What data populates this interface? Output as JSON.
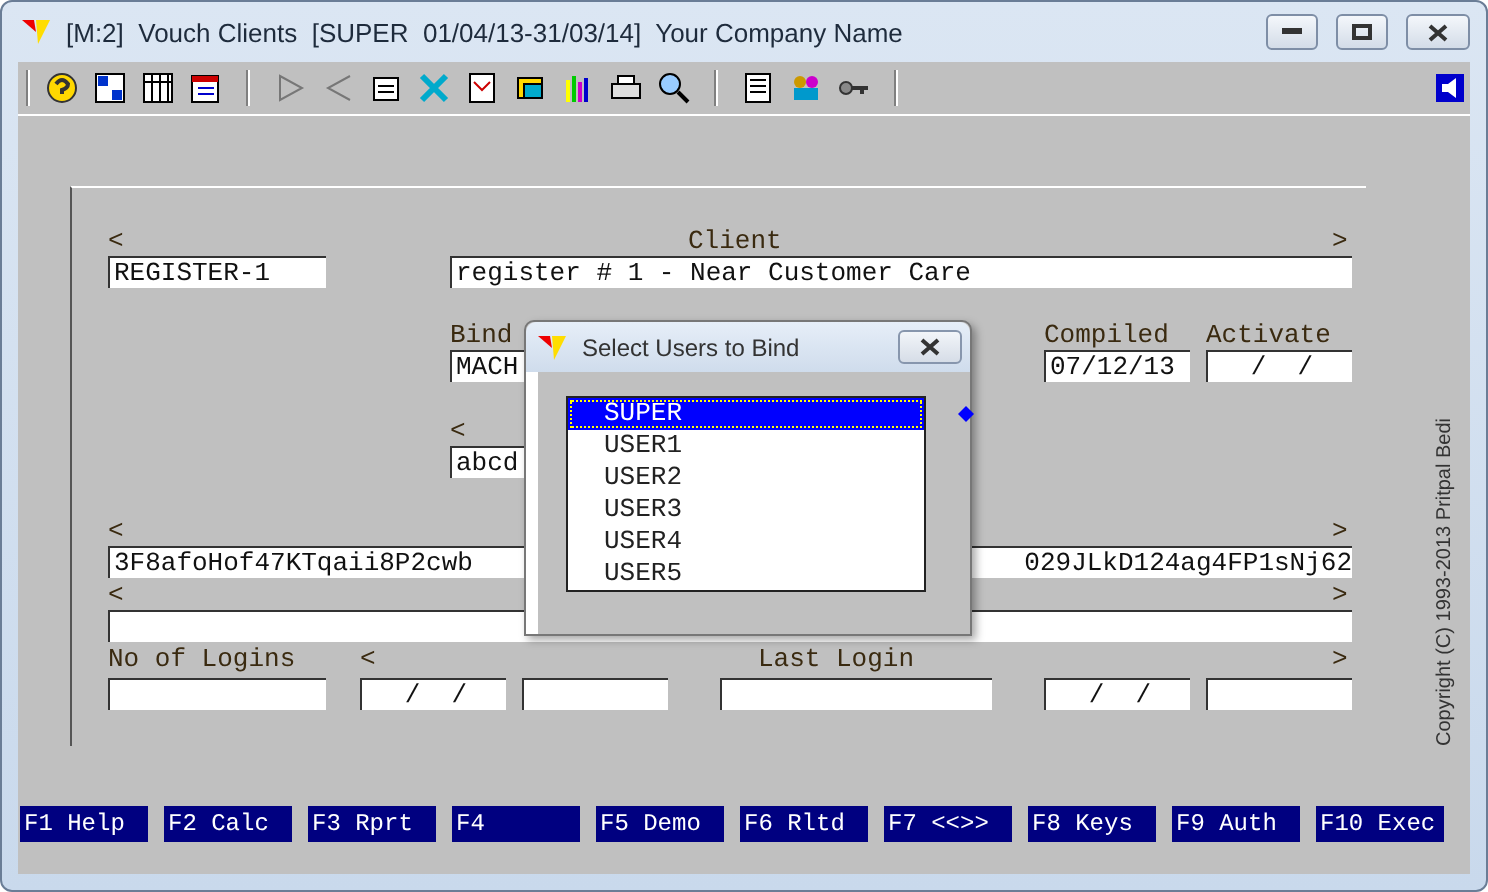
{
  "window": {
    "title": "[M:2]  Vouch Clients  [SUPER  01/04/13-31/03/14]  Your Company Name"
  },
  "form": {
    "code_marker": "<",
    "client_label": "Client",
    "client_marker": ">",
    "code": "REGISTER-1",
    "client": "register # 1 - Near Customer Care",
    "bind_label": "Bind",
    "bind": "MACH",
    "compiled_label": "Compiled",
    "compiled": "07/12/13",
    "activate_label": "Activate",
    "activate": "/  /",
    "field_5_marker": "<",
    "field_5": "abcd",
    "key_marker_left": "<",
    "key_marker_right": ">",
    "key_start": "3F8afoHof47KTqaii8P2cwb",
    "key_end": "029JLkD124ag4FP1sNj62",
    "note_marker_left": "<",
    "note_marker_right": ">",
    "logins_label": "No of Logins",
    "last_marker_left": "<",
    "last_login_label": "Last Login",
    "last_marker_right": ">",
    "last_date": "/  /",
    "expiry_date": "/  /"
  },
  "dialog": {
    "title": "Select Users to Bind",
    "items": [
      {
        "label": "SUPER",
        "selected": true
      },
      {
        "label": "USER1",
        "selected": false
      },
      {
        "label": "USER2",
        "selected": false
      },
      {
        "label": "USER3",
        "selected": false
      },
      {
        "label": "USER4",
        "selected": false
      },
      {
        "label": "USER5",
        "selected": false
      }
    ]
  },
  "copyright": "Copyright (C) 1993-2013  Pritpal Bedi",
  "function_keys": [
    "F1 Help",
    "F2 Calc",
    "F3 Rprt",
    "F4",
    "F5 Demo",
    "F6 Rltd",
    "F7 <<>>",
    "F8 Keys",
    "F9 Auth",
    "F10 Exec"
  ]
}
